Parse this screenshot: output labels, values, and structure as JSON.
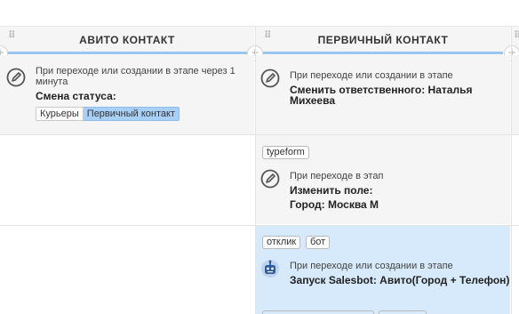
{
  "columns": [
    {
      "title": "АВИТО КОНТАКТ"
    },
    {
      "title": "ПЕРВИЧНЫЙ КОНТАКТ"
    }
  ],
  "icons": {
    "drag": "drag-handle-icon",
    "plus": "plus-icon",
    "edit": "edit-pencil-icon",
    "bot": "salesbot-icon"
  },
  "colors": {
    "accent": "#9bc6f4",
    "selected_tag": "#a8d0f7",
    "bot_row": "#d6eafb",
    "column_bg": "#f5f5f5"
  },
  "avito": {
    "trigger_line1": "При переходе или создании в этапе через 1",
    "trigger_line2": "минута",
    "action": "Смена статуса:",
    "status_tags": [
      "Курьеры",
      "Первичный контакт"
    ]
  },
  "primary": {
    "row1": {
      "trigger": "При переходе или создании в этапе",
      "action": "Сменить ответственного: Наталья Михеева"
    },
    "row2": {
      "chip": "typeform",
      "trigger": "При переходе в этап",
      "action_line1": "Изменить поле:",
      "action_line2": "Город: Москва М"
    },
    "row3": {
      "chips": [
        "отклик",
        "бот"
      ],
      "trigger": "При переходе или создании в этапе",
      "action": "Запуск Salesbot: Авито(Город + Телефон)"
    }
  }
}
